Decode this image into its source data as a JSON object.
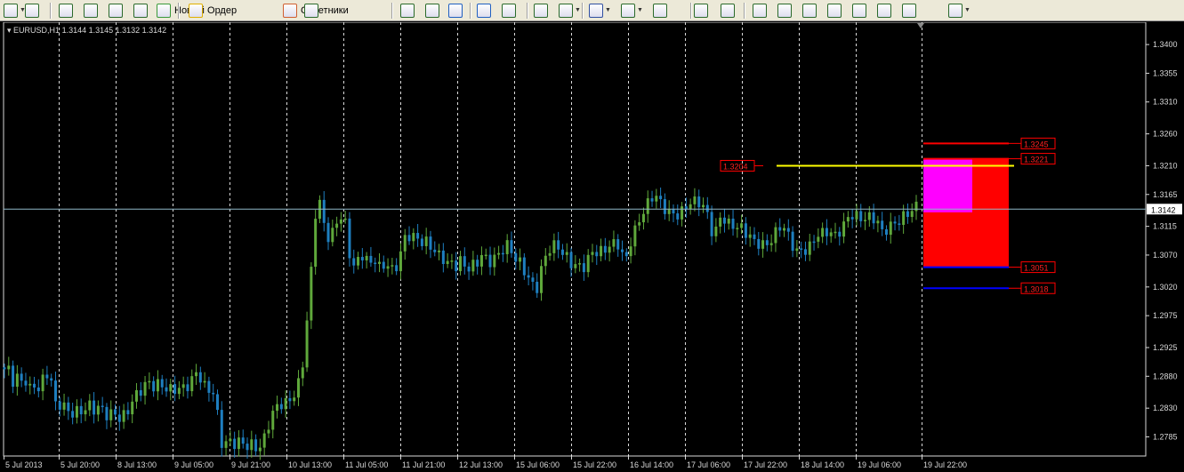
{
  "toolbar": {
    "new_order_label": "Новый Ордер",
    "advisors_label": "Советники",
    "icons": [
      "chart-profile-icon",
      "new-chart-icon",
      "navigator-icon",
      "favorites-icon",
      "data-window-icon",
      "strategy-tester-icon",
      "new-order-icon",
      "alert-icon",
      "expert-advisors-icon",
      "bar-chart-icon",
      "candles-icon",
      "line-chart-icon",
      "zoom-in-icon",
      "zoom-out-icon",
      "autoscroll-icon",
      "chart-shift-icon",
      "indicators-icon",
      "periods-icon",
      "templates-icon",
      "cursor-icon",
      "crosshair-icon",
      "vertical-line-icon",
      "trendline-icon",
      "fibo-icon",
      "text-icon",
      "text-label-icon",
      "fibo-fan-icon",
      "channel-icon",
      "rectangle-icon",
      "arrows-icon"
    ]
  },
  "chart_header": {
    "symbol": "EURUSD,H1",
    "ohlc": "1.3144 1.3145 1.3132 1.3142"
  },
  "chart_data": {
    "type": "candlestick",
    "symbol": "EURUSD",
    "timeframe": "H1",
    "ylim": [
      1.2755,
      1.3435
    ],
    "price_ticks": [
      "1.3400",
      "1.3355",
      "1.3310",
      "1.3260",
      "1.3210",
      "1.3165",
      "1.3115",
      "1.3070",
      "1.3020",
      "1.2975",
      "1.2925",
      "1.2880",
      "1.2830",
      "1.2785"
    ],
    "time_ticks": [
      "5 Jul 2013",
      "5 Jul 20:00",
      "8 Jul 13:00",
      "9 Jul 05:00",
      "9 Jul 21:00",
      "10 Jul 13:00",
      "11 Jul 05:00",
      "11 Jul 21:00",
      "12 Jul 13:00",
      "15 Jul 06:00",
      "15 Jul 22:00",
      "16 Jul 14:00",
      "17 Jul 06:00",
      "17 Jul 22:00",
      "18 Jul 14:00",
      "19 Jul 06:00",
      "19 Jul 22:00"
    ],
    "current_price": "1.3142",
    "path_points": [
      1.2885,
      1.2885,
      1.287,
      1.288,
      1.2875,
      1.288,
      1.2865,
      1.287,
      1.286,
      1.287,
      1.288,
      1.287,
      1.283,
      1.2835,
      1.2835,
      1.283,
      1.2828,
      1.283,
      1.2828,
      1.2828,
      1.2832,
      1.2822,
      1.2825,
      1.2825,
      1.2818,
      1.2822,
      1.2828,
      1.282,
      1.2822,
      1.2825,
      1.2838,
      1.2845,
      1.285,
      1.2858,
      1.2868,
      1.2862,
      1.287,
      1.2872,
      1.2868,
      1.2865,
      1.286,
      1.2862,
      1.2855,
      1.2858,
      1.2862,
      1.288,
      1.2885,
      1.287,
      1.2865,
      1.2862,
      1.286,
      1.278,
      1.2772,
      1.2775,
      1.2768,
      1.277,
      1.2775,
      1.277,
      1.2775,
      1.2778,
      1.277,
      1.278,
      1.279,
      1.2815,
      1.2822,
      1.283,
      1.2832,
      1.2835,
      1.2845,
      1.286,
      1.288,
      1.292,
      1.3,
      1.307,
      1.3165,
      1.314,
      1.31,
      1.309,
      1.3105,
      1.3128,
      1.3135,
      1.312,
      1.3065,
      1.3055,
      1.3065,
      1.307,
      1.3055,
      1.305,
      1.306,
      1.3045,
      1.3055,
      1.306,
      1.305,
      1.306,
      1.308,
      1.31,
      1.3098,
      1.3092,
      1.309,
      1.3085,
      1.3088,
      1.3085,
      1.308,
      1.3075,
      1.307,
      1.306,
      1.3058,
      1.305,
      1.3055,
      1.3048,
      1.3045,
      1.3052,
      1.306,
      1.3075,
      1.307,
      1.3065,
      1.3068,
      1.307,
      1.3075,
      1.308,
      1.3072,
      1.306,
      1.3058,
      1.305,
      1.304,
      1.303,
      1.302,
      1.3045,
      1.3065,
      1.3075,
      1.3078,
      1.308,
      1.307,
      1.3068,
      1.3062,
      1.3058,
      1.306,
      1.3055,
      1.306,
      1.3075,
      1.307,
      1.3068,
      1.3072,
      1.308,
      1.3085,
      1.3095,
      1.3085,
      1.306,
      1.309,
      1.3105,
      1.3115,
      1.313,
      1.314,
      1.315,
      1.3165,
      1.3155,
      1.315,
      1.3145,
      1.314,
      1.3138,
      1.3135,
      1.314,
      1.3145,
      1.315,
      1.3145,
      1.3152,
      1.314,
      1.313,
      1.31,
      1.3125,
      1.314,
      1.312,
      1.3115,
      1.311,
      1.3108,
      1.3105,
      1.31,
      1.3098,
      1.3092,
      1.3095,
      1.309,
      1.3092,
      1.3098,
      1.3105,
      1.3112,
      1.3105,
      1.309,
      1.308,
      1.3075,
      1.3082,
      1.3085,
      1.309,
      1.31,
      1.3105,
      1.31,
      1.3102,
      1.3098,
      1.3095,
      1.3108,
      1.312,
      1.3135,
      1.314,
      1.3135,
      1.313,
      1.3128,
      1.3125,
      1.3122,
      1.3115,
      1.31,
      1.311,
      1.3118,
      1.3125,
      1.313,
      1.3135,
      1.3138,
      1.314,
      1.3142
    ],
    "annotations": {
      "yellow_line": {
        "price": 1.321,
        "label": "1.3204",
        "color": "#ffff00"
      },
      "levels": [
        {
          "price": 1.3245,
          "label": "1.3245",
          "color": "#ff0000"
        },
        {
          "price": 1.3221,
          "label": "1.3221",
          "color": "#ff0000"
        },
        {
          "price": 1.3051,
          "label": "1.3051",
          "color": "#0000ff"
        },
        {
          "price": 1.3018,
          "label": "1.3018",
          "color": "#0000ff"
        }
      ],
      "magenta_zone": {
        "top": 1.3221,
        "bottom": 1.3137,
        "color": "#ff00ff"
      },
      "red_zone": {
        "top": 1.3221,
        "bottom": 1.3051,
        "color": "#ff0000"
      }
    },
    "colors": {
      "bull": "#5fa83b",
      "bear": "#1e7fc0",
      "grid": "#ffffff",
      "background": "#000000"
    }
  }
}
